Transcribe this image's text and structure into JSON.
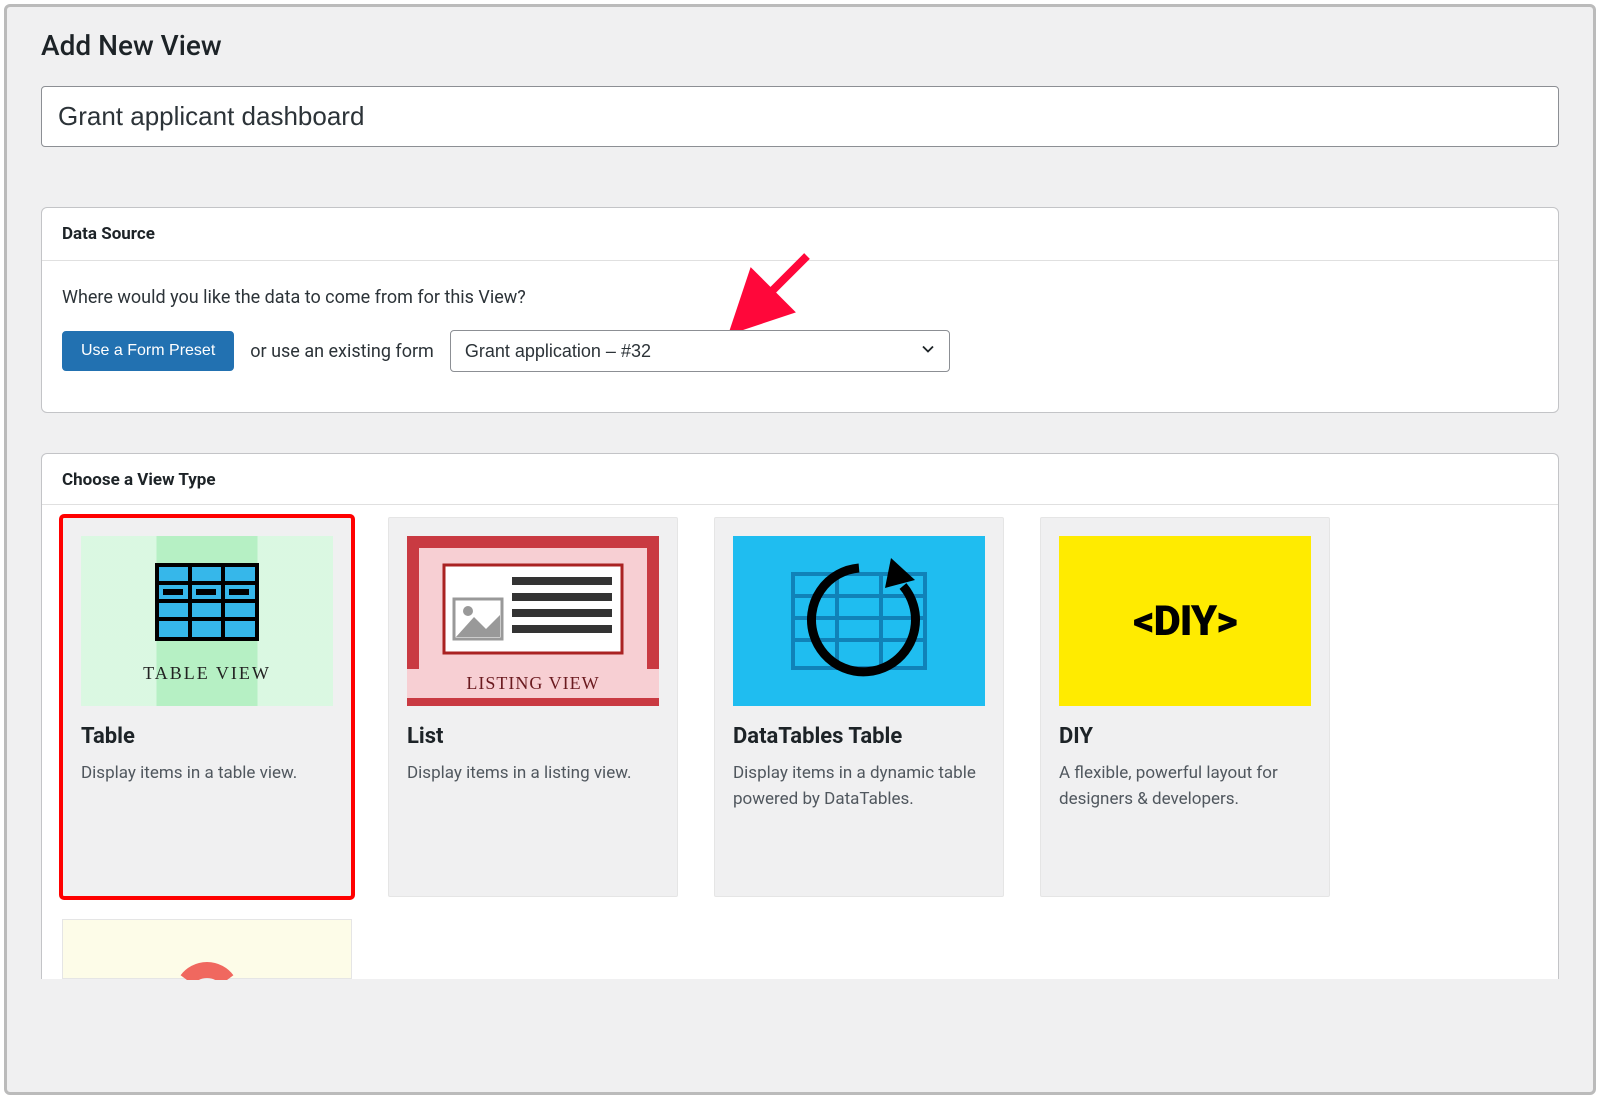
{
  "page_title": "Add New View",
  "title_input_value": "Grant applicant dashboard",
  "data_source": {
    "heading": "Data Source",
    "prompt": "Where would you like the data to come from for this View?",
    "preset_button": "Use a Form Preset",
    "or_text": "or use an existing form",
    "selected_form": "Grant application – #32"
  },
  "view_type": {
    "heading": "Choose a View Type",
    "cards": [
      {
        "key": "table",
        "title": "Table",
        "desc": "Display items in a table view.",
        "thumb_caption": "TABLE VIEW",
        "selected": true
      },
      {
        "key": "list",
        "title": "List",
        "desc": "Display items in a listing view.",
        "thumb_caption": "LISTING VIEW",
        "selected": false
      },
      {
        "key": "datatables",
        "title": "DataTables Table",
        "desc": "Display items in a dynamic table powered by DataTables.",
        "thumb_caption": "",
        "selected": false
      },
      {
        "key": "diy",
        "title": "DIY",
        "desc": "A flexible, powerful layout for designers & developers.",
        "thumb_caption": "<DIY>",
        "selected": false
      }
    ]
  }
}
